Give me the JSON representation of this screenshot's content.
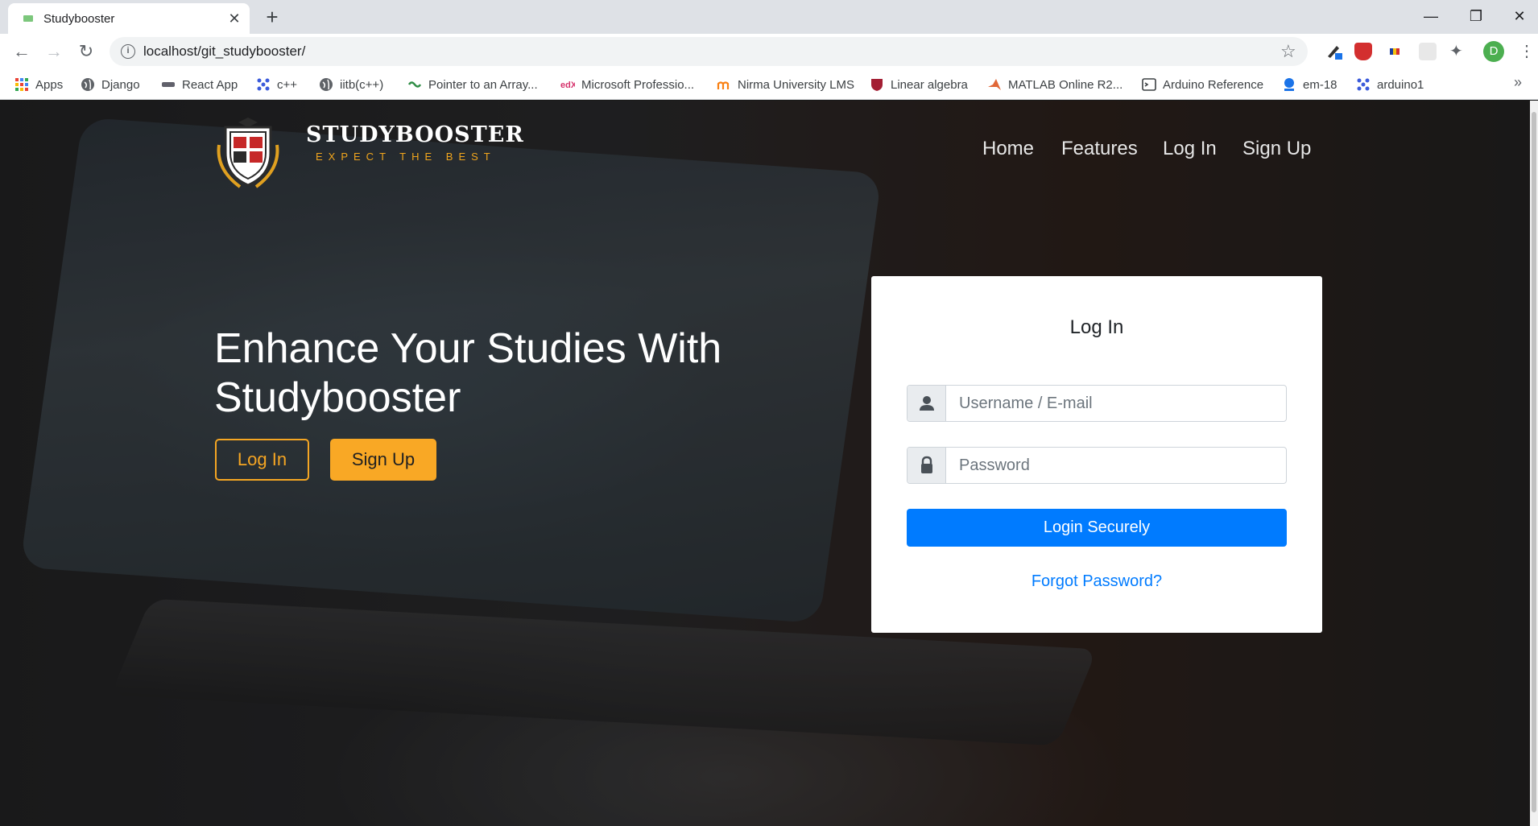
{
  "browser": {
    "tab_title": "Studybooster",
    "tab_close": "✕",
    "new_tab": "+",
    "url": "localhost/git_studybooster/",
    "profile_initial": "D",
    "window_controls": {
      "minimize": "—",
      "maximize": "❐",
      "close": "✕"
    },
    "nav": {
      "back": "←",
      "forward": "→",
      "reload": "↻"
    },
    "bookmarks": [
      {
        "label": "Apps",
        "icon": "apps-grid-icon"
      },
      {
        "label": "Django",
        "icon": "globe-icon"
      },
      {
        "label": "React App",
        "icon": "react-icon"
      },
      {
        "label": "c++",
        "icon": "dots-icon"
      },
      {
        "label": "iitb(c++)",
        "icon": "globe-icon"
      },
      {
        "label": "Pointer to an Array...",
        "icon": "gfg-icon"
      },
      {
        "label": "Microsoft Professio...",
        "icon": "edx-icon"
      },
      {
        "label": "Nirma University LMS",
        "icon": "moodle-icon"
      },
      {
        "label": "Linear algebra",
        "icon": "shield-icon"
      },
      {
        "label": "MATLAB Online R2...",
        "icon": "matlab-icon"
      },
      {
        "label": "Arduino Reference",
        "icon": "terminal-icon"
      },
      {
        "label": "em-18",
        "icon": "jio-icon"
      },
      {
        "label": "arduino1",
        "icon": "dots-icon"
      }
    ],
    "bookmarks_more": "»"
  },
  "site": {
    "brand": "STUDYBOOSTER",
    "tagline": "EXPECT THE BEST",
    "nav": [
      "Home",
      "Features",
      "Log In",
      "Sign Up"
    ],
    "hero": {
      "title": "Enhance Your Studies With Studybooster",
      "login_button": "Log In",
      "signup_button": "Sign Up"
    },
    "login_card": {
      "title": "Log In",
      "username_placeholder": "Username / E-mail",
      "password_placeholder": "Password",
      "submit": "Login Securely",
      "forgot": "Forgot Password?"
    },
    "colors": {
      "accent": "#f9a825",
      "primary": "#007bff"
    }
  }
}
